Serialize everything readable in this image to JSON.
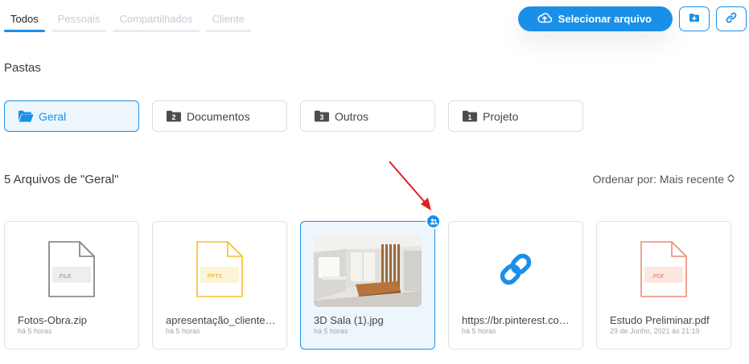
{
  "tabs": [
    {
      "label": "Todos",
      "active": true
    },
    {
      "label": "Pessoais",
      "active": false
    },
    {
      "label": "Compartilhados",
      "active": false
    },
    {
      "label": "Cliente",
      "active": false
    }
  ],
  "actions": {
    "upload_label": "Selecionar arquivo",
    "upload_icon": "cloud-upload-icon",
    "new_folder_icon": "folder-plus-icon",
    "link_icon": "link-icon"
  },
  "folders_section": {
    "title": "Pastas",
    "items": [
      {
        "label": "Geral",
        "badge": "",
        "active": true
      },
      {
        "label": "Documentos",
        "badge": "2",
        "active": false
      },
      {
        "label": "Outros",
        "badge": "3",
        "active": false
      },
      {
        "label": "Projeto",
        "badge": "1",
        "active": false
      }
    ]
  },
  "files_section": {
    "title": "5 Arquivos de \"Geral\"",
    "sort_label": "Ordenar por: Mais recente",
    "items": [
      {
        "name": "Fotos-Obra.zip",
        "time": "há 5 horas",
        "type_label": ".FILE",
        "kind": "file",
        "color": "#7a7a7a",
        "shared": false,
        "active": false
      },
      {
        "name": "apresentação_cliente.pptx",
        "time": "há 5 horas",
        "type_label": ".PPTX",
        "kind": "file",
        "color": "#f3bd2f",
        "shared": false,
        "active": false
      },
      {
        "name": "3D Sala (1).jpg",
        "time": "há 5 horas",
        "type_label": "",
        "kind": "image",
        "color": "#1a8fe8",
        "shared": true,
        "active": true
      },
      {
        "name": "https://br.pinterest.com/pin/",
        "time": "há 5 horas",
        "type_label": "",
        "kind": "link",
        "color": "#1a8fe8",
        "shared": false,
        "active": false
      },
      {
        "name": "Estudo Preliminar.pdf",
        "time": "29 de Junho, 2021 às 21:19",
        "type_label": ".PDF",
        "kind": "file",
        "color": "#ef8a74",
        "shared": false,
        "active": false
      }
    ]
  },
  "colors": {
    "accent": "#1a8fe8",
    "annotation": "#e02020"
  }
}
